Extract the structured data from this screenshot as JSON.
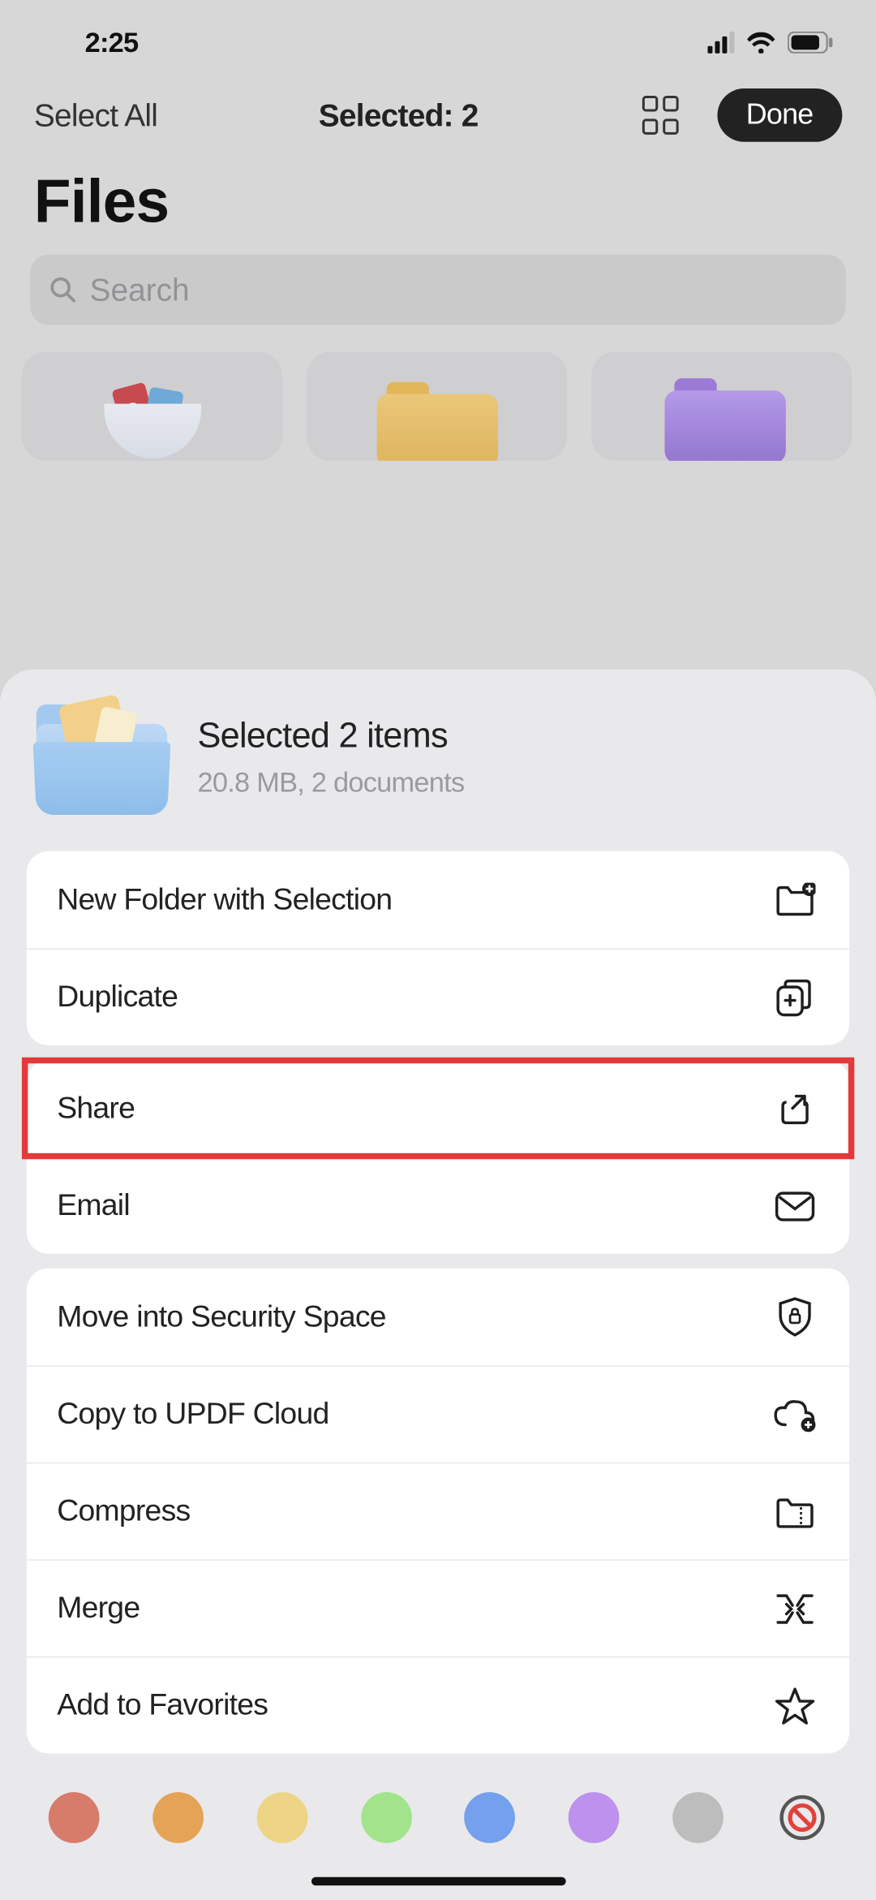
{
  "status": {
    "time": "2:25"
  },
  "toolbar": {
    "select_all": "Select All",
    "selected": "Selected: 2",
    "done": "Done"
  },
  "page": {
    "title": "Files"
  },
  "search": {
    "placeholder": "Search"
  },
  "sheet": {
    "title": "Selected 2 items",
    "subtitle": "20.8 MB, 2 documents",
    "group1": [
      {
        "label": "New Folder with Selection"
      },
      {
        "label": "Duplicate"
      }
    ],
    "group2": [
      {
        "label": "Share"
      },
      {
        "label": "Email"
      }
    ],
    "group3": [
      {
        "label": "Move into Security Space"
      },
      {
        "label": "Copy to UPDF Cloud"
      },
      {
        "label": "Compress"
      },
      {
        "label": "Merge"
      },
      {
        "label": "Add to Favorites"
      }
    ]
  },
  "colors": [
    "#d77b6b",
    "#e4a356",
    "#eed585",
    "#a1e48b",
    "#74a0ee",
    "#bd91ed",
    "#bdbdbd"
  ]
}
